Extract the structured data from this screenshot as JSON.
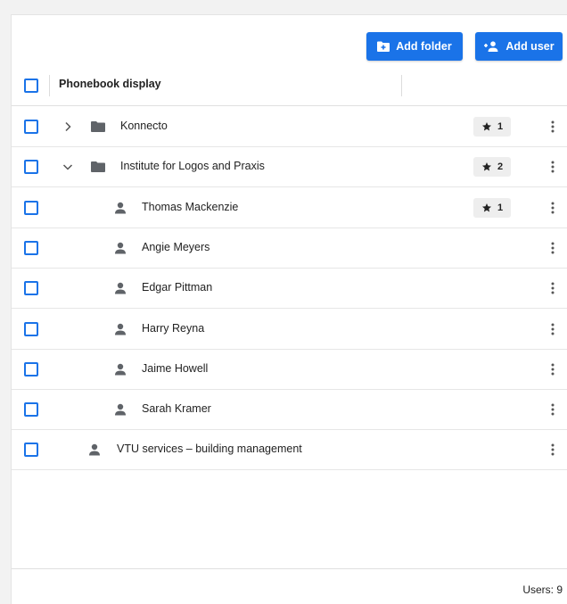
{
  "toolbar": {
    "add_folder_label": "Add folder",
    "add_user_label": "Add user"
  },
  "table": {
    "column_header": "Phonebook display"
  },
  "rows": [
    {
      "type": "folder",
      "label": "Konnecto",
      "expander": "chevron-right",
      "badge": "1"
    },
    {
      "type": "folder",
      "label": "Institute for Logos and Praxis",
      "expander": "chevron-down",
      "badge": "2"
    },
    {
      "type": "user",
      "label": "Thomas Mackenzie",
      "badge": "1"
    },
    {
      "type": "user",
      "label": "Angie Meyers"
    },
    {
      "type": "user",
      "label": "Edgar Pittman"
    },
    {
      "type": "user",
      "label": "Harry Reyna"
    },
    {
      "type": "user",
      "label": "Jaime Howell"
    },
    {
      "type": "user",
      "label": "Sarah Kramer"
    },
    {
      "type": "user",
      "label": "VTU services – building management"
    }
  ],
  "footer": {
    "users_count": "Users: 9"
  },
  "colors": {
    "accent": "#1a73e8",
    "icon_gray": "#5f6368"
  }
}
